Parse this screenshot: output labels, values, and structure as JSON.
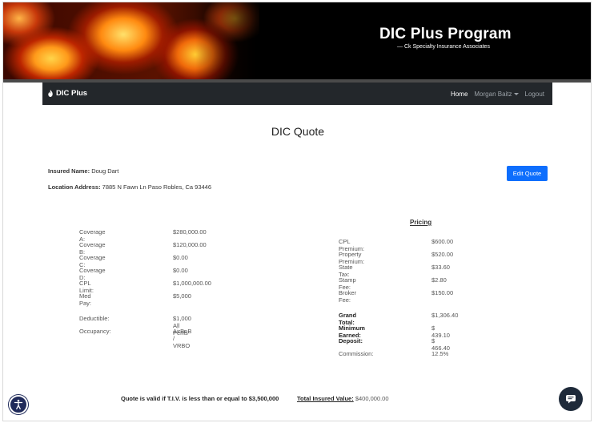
{
  "header": {
    "title": "DIC Plus Program",
    "subtitle": "— Ck Specialty Insurance Associates"
  },
  "nav": {
    "brand": "DIC Plus",
    "links": [
      "Home",
      "Morgan Baitz",
      "Logout"
    ]
  },
  "page_title": "DIC Quote",
  "insured": {
    "name_label": "Insured Name:",
    "name_value": "Doug Dart",
    "address_label": "Location Address:",
    "address_value": "7885 N Fawn Ln Paso Robles, Ca 93446"
  },
  "edit_quote_label": "Edit Quote",
  "coverage": [
    {
      "label": "Coverage A:",
      "value": "$280,000.00"
    },
    {
      "label": "Coverage B:",
      "value": "$120,000.00"
    },
    {
      "label": "Coverage C:",
      "value": "$0.00"
    },
    {
      "label": "Coverage D:",
      "value": "$0.00"
    },
    {
      "label": "CPL Limit:",
      "value": "$1,000,000.00"
    },
    {
      "label": "Med Pay:",
      "value": "$5,000"
    },
    {
      "label": "Deductible:",
      "value": "$1,000 All Perils"
    },
    {
      "label": "Occupancy:",
      "value": "AirBnB / VRBO"
    }
  ],
  "pricing_title": "Pricing",
  "pricing": [
    {
      "label": "CPL Premium:",
      "value": "$600.00"
    },
    {
      "label": "Property Premium:",
      "value": "$520.00"
    },
    {
      "label": "State Tax:",
      "value": "$33.60"
    },
    {
      "label": "Stamp Fee:",
      "value": "$2.80"
    },
    {
      "label": "Broker Fee:",
      "value": "$150.00"
    },
    {
      "label": "Grand Total:",
      "value": "$1,306.40"
    },
    {
      "label": "Minimum Earned:",
      "value": "$ 439.10"
    },
    {
      "label": "Deposit:",
      "value": "$ 466.40"
    },
    {
      "label": "Commission:",
      "value": "12.5%"
    }
  ],
  "footer": {
    "validity": "Quote is valid if T.I.V. is less than or equal to $3,500,000",
    "tiv_label": "Total Insured Value:",
    "tiv_value": "$400,000.00"
  },
  "icons": {
    "brand": "fire-icon",
    "accessibility": "accessibility-icon",
    "chat": "chat-icon"
  },
  "colors": {
    "navbar": "#23272b",
    "primary_button": "#0d6efd"
  }
}
